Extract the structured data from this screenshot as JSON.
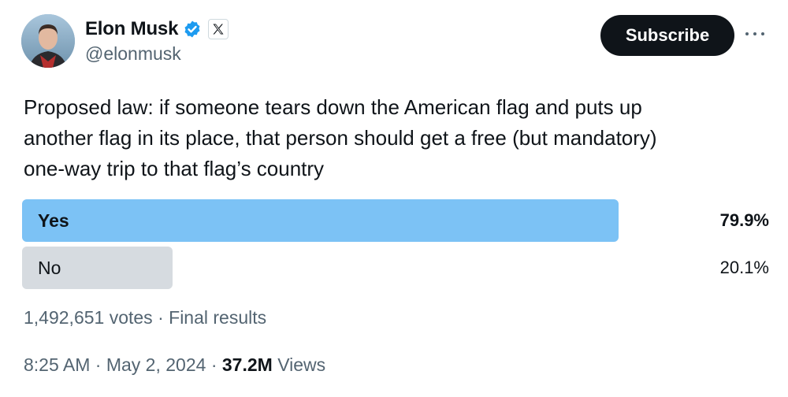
{
  "author": {
    "display_name": "Elon Musk",
    "handle": "@elonmusk",
    "verified_icon": "verified-badge-icon",
    "affiliate_icon": "x-logo-icon"
  },
  "actions": {
    "subscribe_label": "Subscribe",
    "more_icon": "more-dots-icon"
  },
  "tweet": {
    "text": "Proposed law: if someone tears down the American flag and puts up\nanother flag in its place, that person should get a free (but mandatory)\none-way trip to that flag’s country"
  },
  "poll": {
    "options": [
      {
        "label": "Yes",
        "percent_label": "79.9%",
        "percent": 79.9,
        "color": "#7cc2f5",
        "winner": true
      },
      {
        "label": "No",
        "percent_label": "20.1%",
        "percent": 20.1,
        "color": "#d6dbe0",
        "winner": false
      }
    ],
    "votes": "1,492,651 votes",
    "separator": " · ",
    "status": "Final results"
  },
  "meta": {
    "time": "8:25 AM",
    "date": "May 2, 2024",
    "separator": " · ",
    "views_count": "37.2M",
    "views_label": " Views"
  },
  "colors": {
    "text_primary": "#0f1419",
    "text_secondary": "#536471",
    "verified_blue": "#1d9bf0",
    "subscribe_bg": "#0f1419"
  }
}
